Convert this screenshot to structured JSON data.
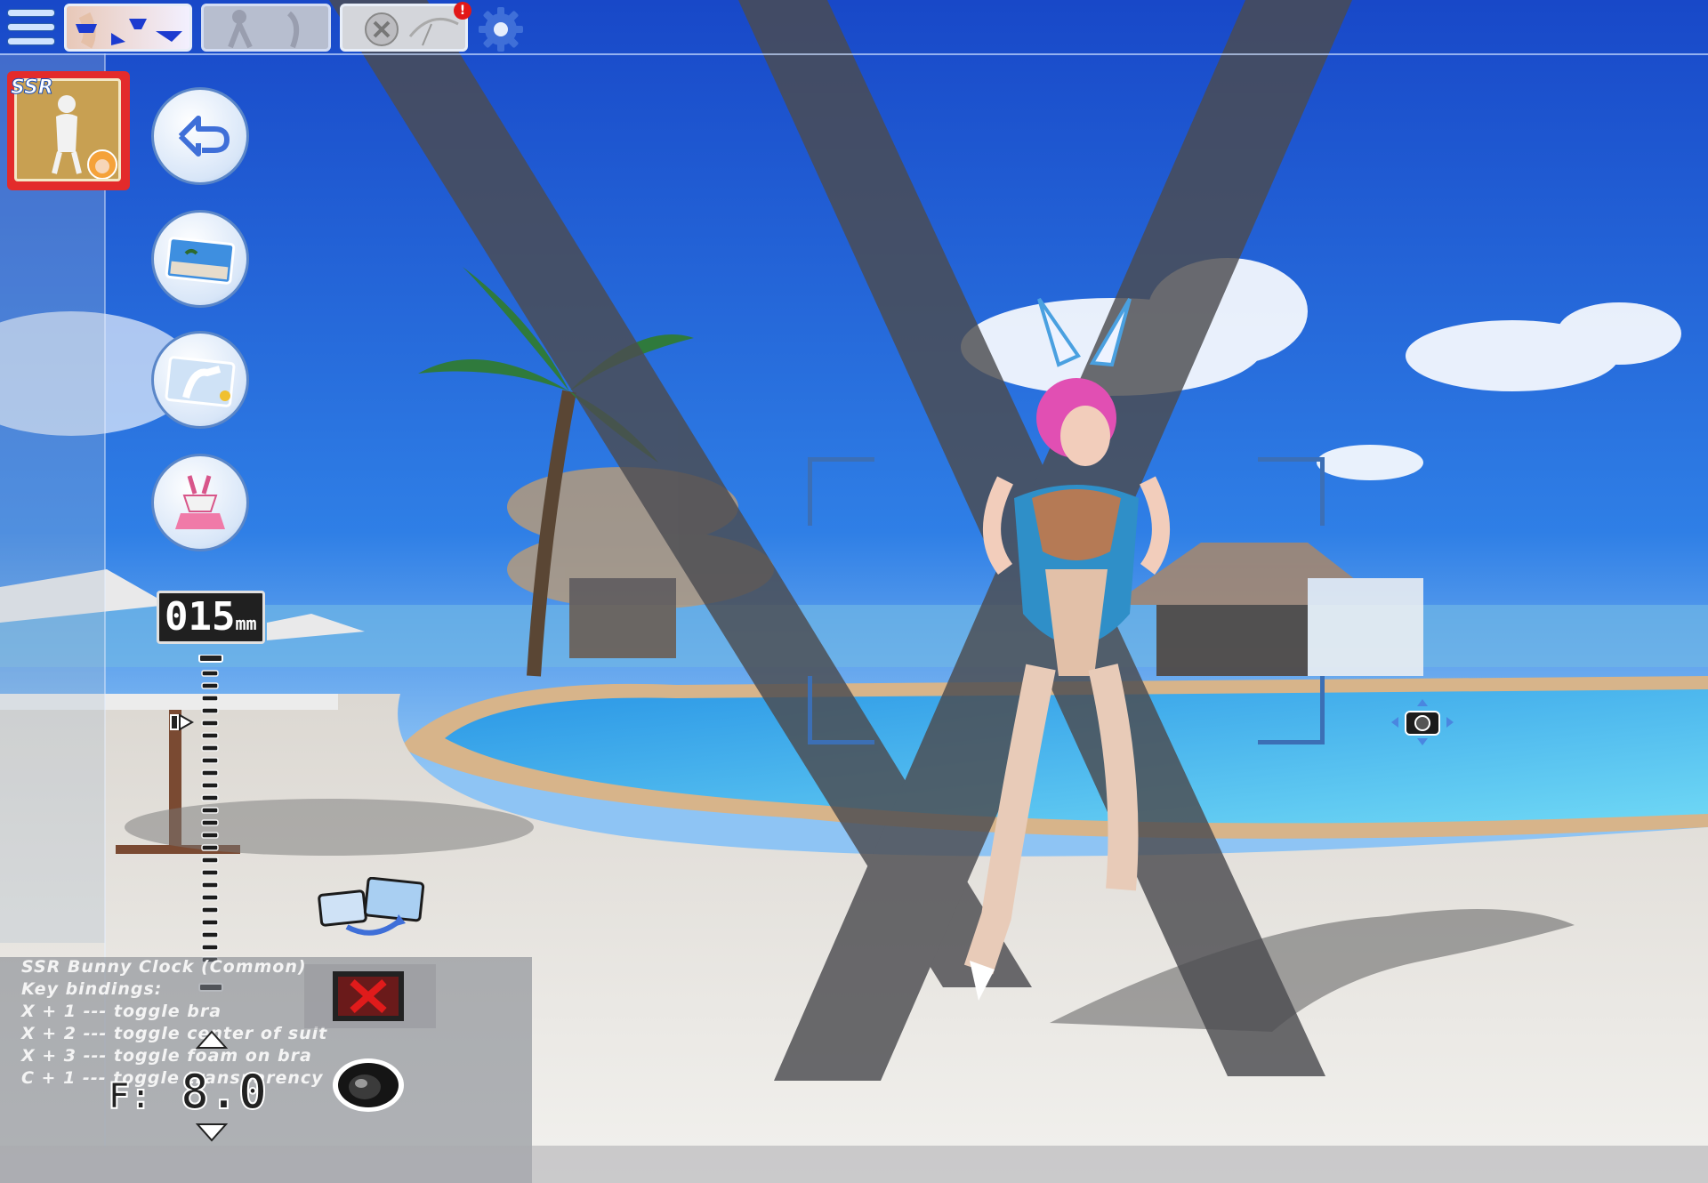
{
  "scene": {
    "sky_color": "#1f5fd8",
    "sea_color": "#3aa6f0",
    "pool_color": "#4fc3f0",
    "sand_color": "#e8e6e2",
    "beam_color": "#4a4a4e"
  },
  "topbar": {
    "menu_icon": "hamburger-menu-icon",
    "tabs": [
      {
        "icon": "swimsuit-outfits-icon",
        "active": true
      },
      {
        "icon": "pose-silhouette-icon",
        "active": false
      },
      {
        "icon": "hidden-item-parasol-icon",
        "active": false,
        "badge": "!"
      }
    ],
    "settings_icon": "gear-icon"
  },
  "card": {
    "rarity": "SSR",
    "icon": "bunny-suit-card-icon"
  },
  "side_buttons": [
    {
      "name": "back-button",
      "icon": "return-arrow-icon"
    },
    {
      "name": "background-button",
      "icon": "beach-scene-icon"
    },
    {
      "name": "pose-button",
      "icon": "pose-card-icon"
    },
    {
      "name": "outfit-button",
      "icon": "bunny-outfit-icon"
    }
  ],
  "camera": {
    "focal_value": "015",
    "focal_unit": "mm",
    "aperture_label": "F:",
    "aperture_value": "8.0"
  },
  "info": {
    "title": "SSR Bunny Clock (Common)",
    "lines": [
      "Key bindings:",
      "X + 1 --- toggle bra",
      "X + 2 --- toggle center of suit",
      "X + 3 --- toggle foam on bra",
      "C + 1 --- toggle transparency"
    ]
  },
  "icons": {
    "swap": "swap-background-icon",
    "close": "close-x-icon",
    "lens": "camera-lens-icon",
    "camera_move": "camera-move-icon"
  },
  "colors": {
    "accent": "#3f6fd8",
    "ssr_frame": "#e32b2b",
    "close_x": "#e01b1b"
  }
}
